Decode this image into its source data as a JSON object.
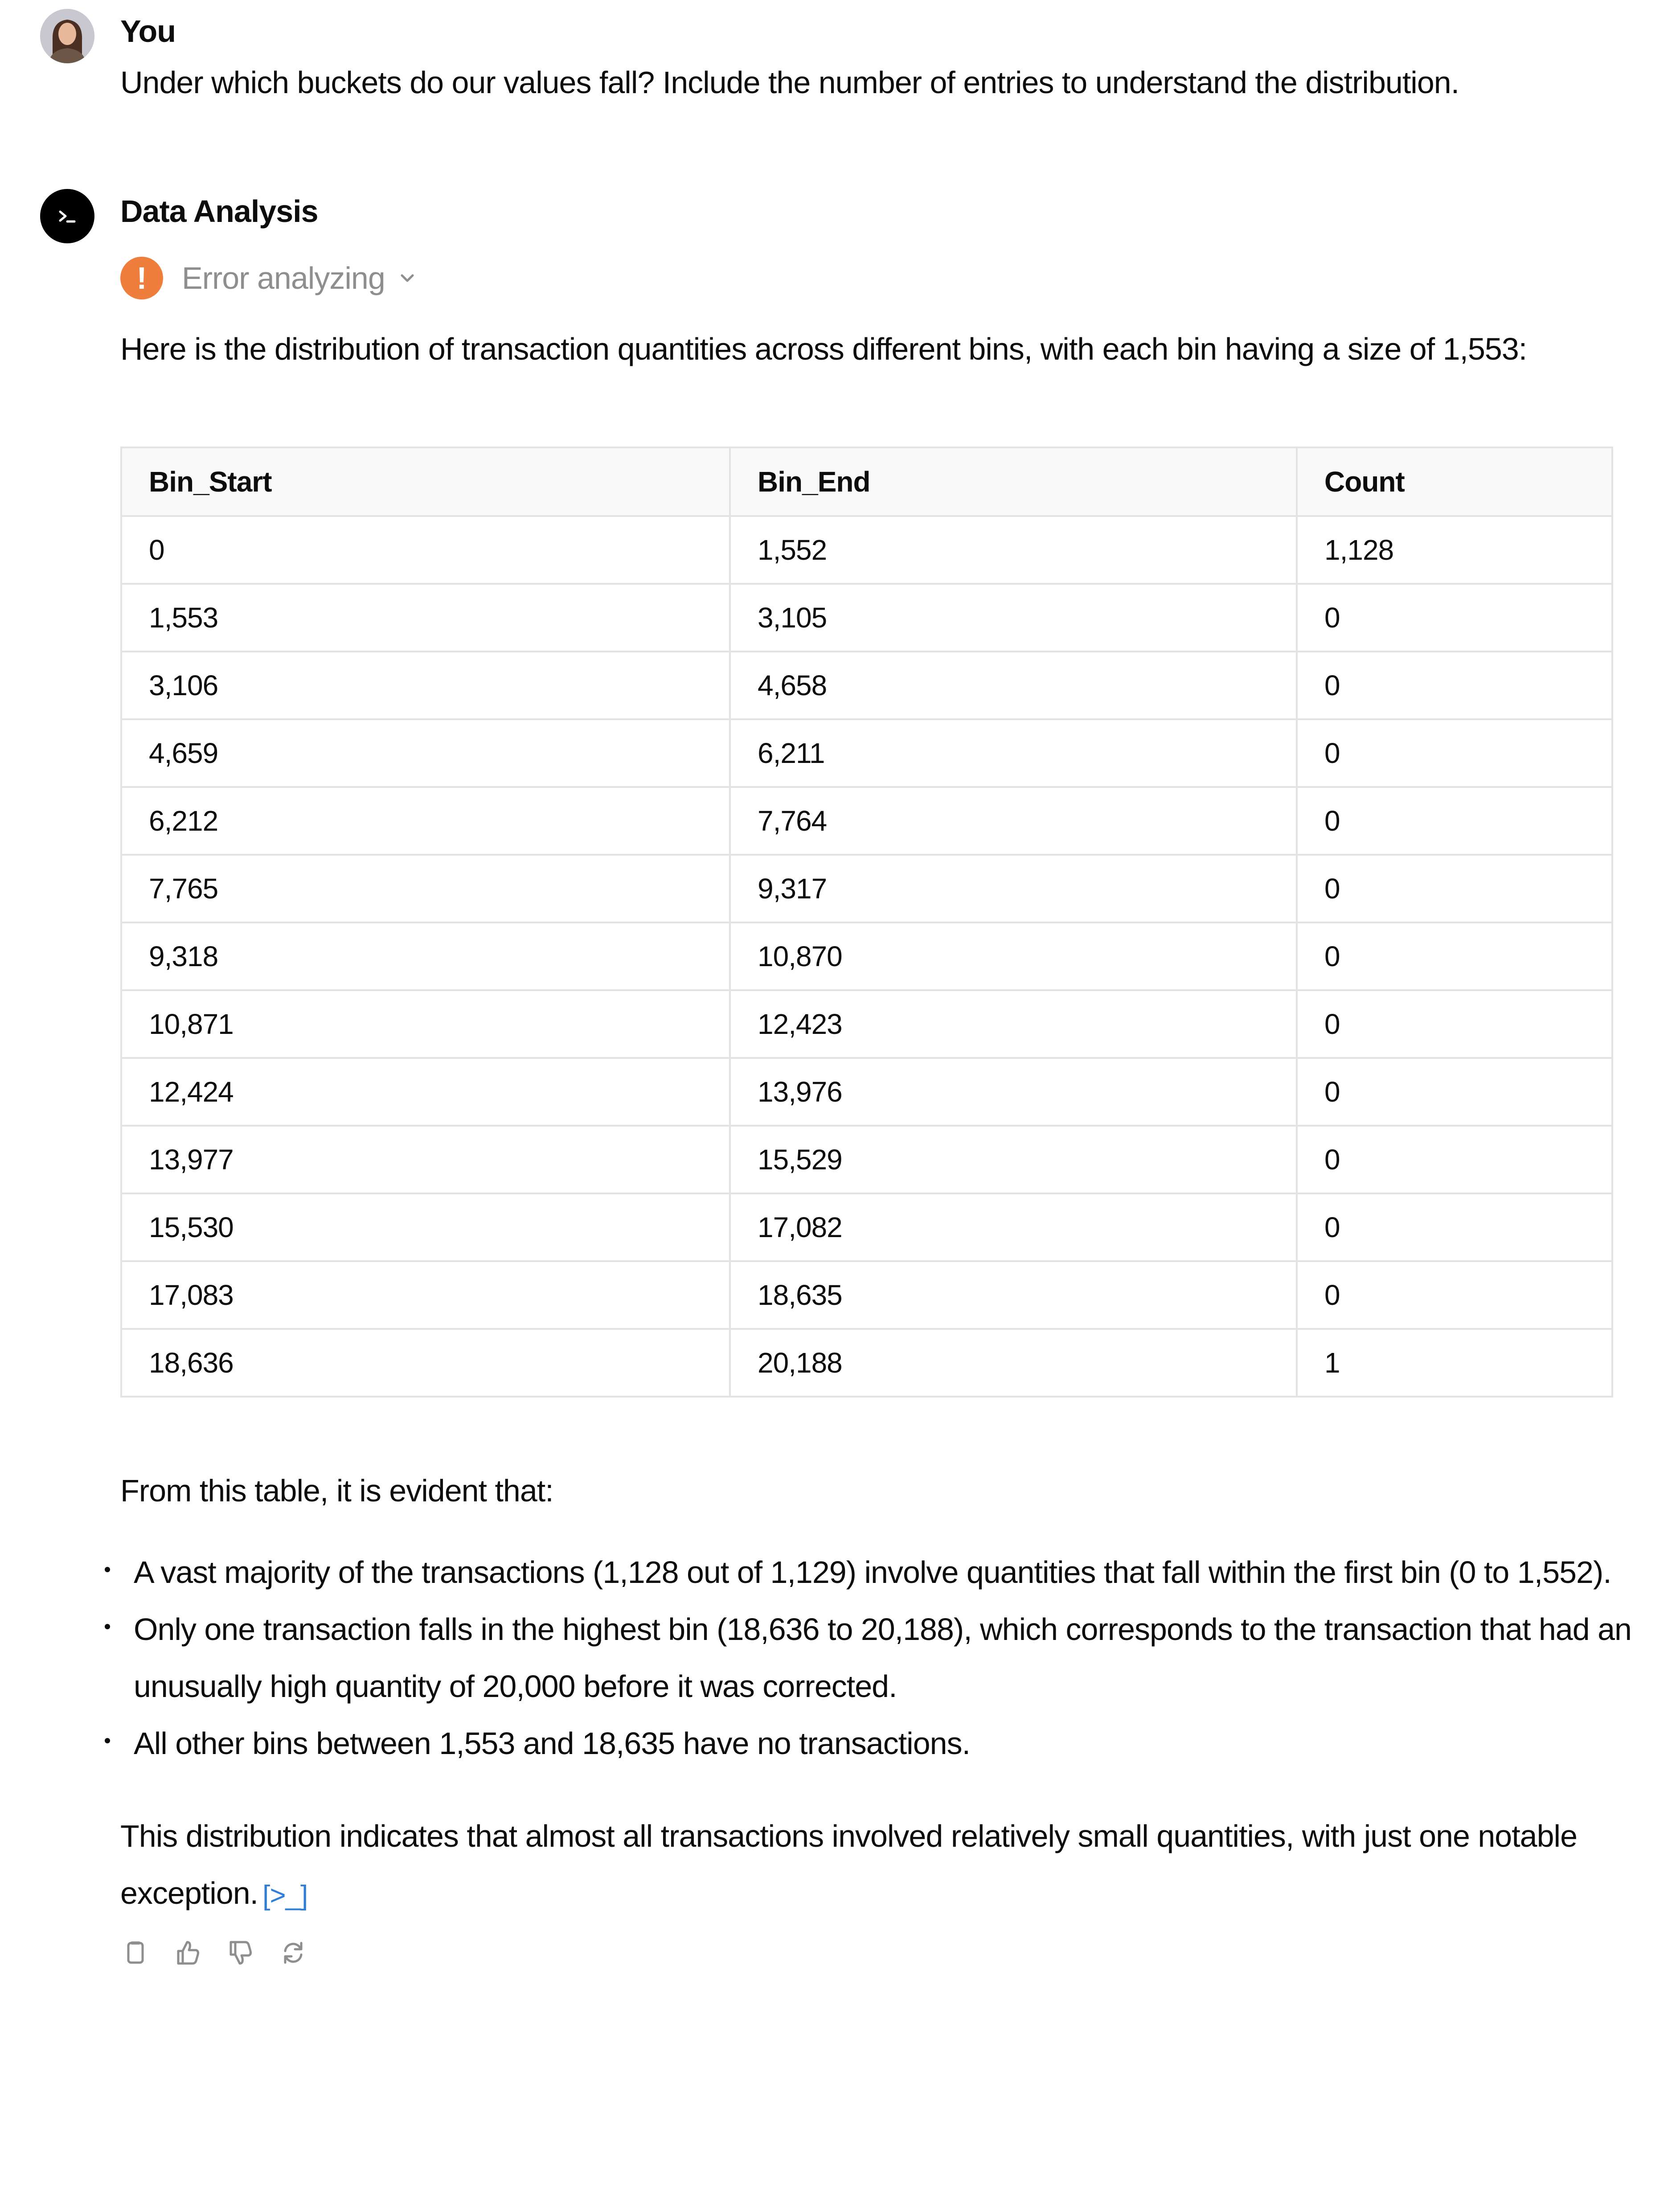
{
  "user_message": {
    "author": "You",
    "text": "Under which buckets do our values fall? Include the number of entries to understand the distribution."
  },
  "assistant_message": {
    "author": "Data Analysis",
    "status": {
      "label": "Error analyzing",
      "icon": "exclamation-icon",
      "color": "#ef7d3c"
    },
    "intro": "Here is the distribution of transaction quantities across different bins, with each bin having a size of 1,553:",
    "table": {
      "headers": [
        "Bin_Start",
        "Bin_End",
        "Count"
      ],
      "rows": [
        [
          "0",
          "1,552",
          "1,128"
        ],
        [
          "1,553",
          "3,105",
          "0"
        ],
        [
          "3,106",
          "4,658",
          "0"
        ],
        [
          "4,659",
          "6,211",
          "0"
        ],
        [
          "6,212",
          "7,764",
          "0"
        ],
        [
          "7,765",
          "9,317",
          "0"
        ],
        [
          "9,318",
          "10,870",
          "0"
        ],
        [
          "10,871",
          "12,423",
          "0"
        ],
        [
          "12,424",
          "13,976",
          "0"
        ],
        [
          "13,977",
          "15,529",
          "0"
        ],
        [
          "15,530",
          "17,082",
          "0"
        ],
        [
          "17,083",
          "18,635",
          "0"
        ],
        [
          "18,636",
          "20,188",
          "1"
        ]
      ]
    },
    "summary_intro": "From this table, it is evident that:",
    "bullets": [
      "A vast majority of the transactions (1,128 out of 1,129) involve quantities that fall within the first bin (0 to 1,552).",
      "Only one transaction falls in the highest bin (18,636 to 20,188), which corresponds to the transaction that had an unusually high quantity of 20,000 before it was corrected.",
      "All other bins between 1,553 and 18,635 have no transactions."
    ],
    "conclusion": "This distribution indicates that almost all transactions involved relatively small quantities, with just one notable exception.",
    "citation_label": "[>_]",
    "actions": [
      "copy-icon",
      "thumbs-up-icon",
      "thumbs-down-icon",
      "regenerate-icon"
    ]
  }
}
